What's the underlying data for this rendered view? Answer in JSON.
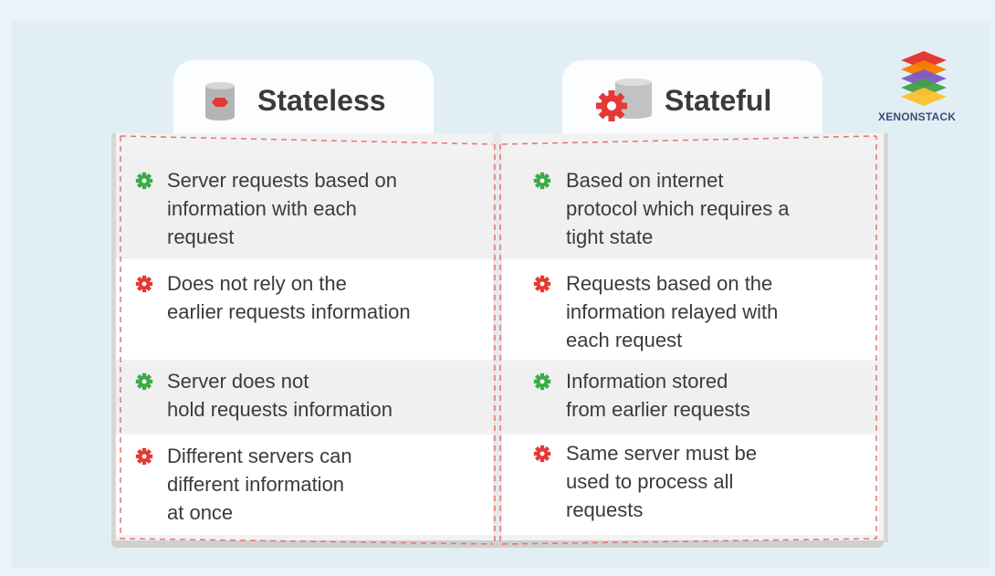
{
  "left_column": {
    "title": "Stateless",
    "items": [
      {
        "text": "Server requests based on\ninformation with each\nrequest",
        "icon": "green-gear-icon"
      },
      {
        "text": "Does not rely on the\nearlier requests information",
        "icon": "red-gear-icon"
      },
      {
        "text": "Server does not\nhold requests information",
        "icon": "green-gear-icon"
      },
      {
        "text": "Different servers can\ndifferent information\nat once",
        "icon": "red-gear-icon"
      }
    ]
  },
  "right_column": {
    "title": "Stateful",
    "items": [
      {
        "text": "Based on internet\nprotocol which requires a\ntight state",
        "icon": "green-gear-icon"
      },
      {
        "text": "Requests based on the\ninformation relayed with\neach request",
        "icon": "red-gear-icon"
      },
      {
        "text": "Information stored\nfrom earlier requests",
        "icon": "green-gear-icon"
      },
      {
        "text": "Same server must be\nused to process all\nrequests",
        "icon": "red-gear-icon"
      }
    ]
  },
  "logo": {
    "text": "XENONSTACK",
    "icon": "stacked-layers-logo-icon"
  },
  "colors": {
    "green": "#3bab47",
    "red": "#e53935",
    "text": "#3b3b3b",
    "dash": "#e57373"
  }
}
